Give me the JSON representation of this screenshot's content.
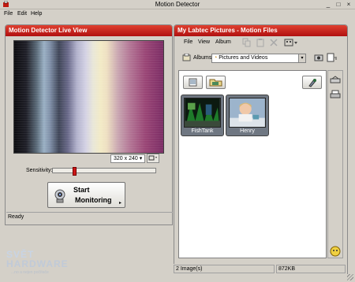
{
  "window": {
    "title": "Motion Detector",
    "minimize": "_",
    "maximize": "□",
    "close": "×"
  },
  "menu": [
    "File",
    "Edit",
    "Help"
  ],
  "live_panel": {
    "title": "Motion Detector Live View",
    "resolution": "320 x 240 ▾",
    "sensitivity_label": "Sensitivity:",
    "sensitivity_level": 0.2,
    "start_line1": "Start",
    "start_line2": "Monitoring",
    "start_arrow": "▸",
    "status": "Ready"
  },
  "pictures_panel": {
    "title": "My Labtec Pictures - Motion Files",
    "menu": [
      "File",
      "View",
      "Album"
    ],
    "albums_label": "Albums",
    "album_selected": "Pictures and Videos",
    "thumbnails": [
      {
        "name": "FishTank"
      },
      {
        "name": "Henry"
      }
    ],
    "status_count": "2 Image(s)",
    "status_size": "872KB"
  },
  "watermark": {
    "line1": "SVĚT",
    "line2": "HARDWARE",
    "line3": "...no a nejen počítače"
  },
  "colors": {
    "header_red": "#c01a12",
    "panel_gray": "#d4d0c8",
    "thumb_bg": "#6f7782"
  }
}
